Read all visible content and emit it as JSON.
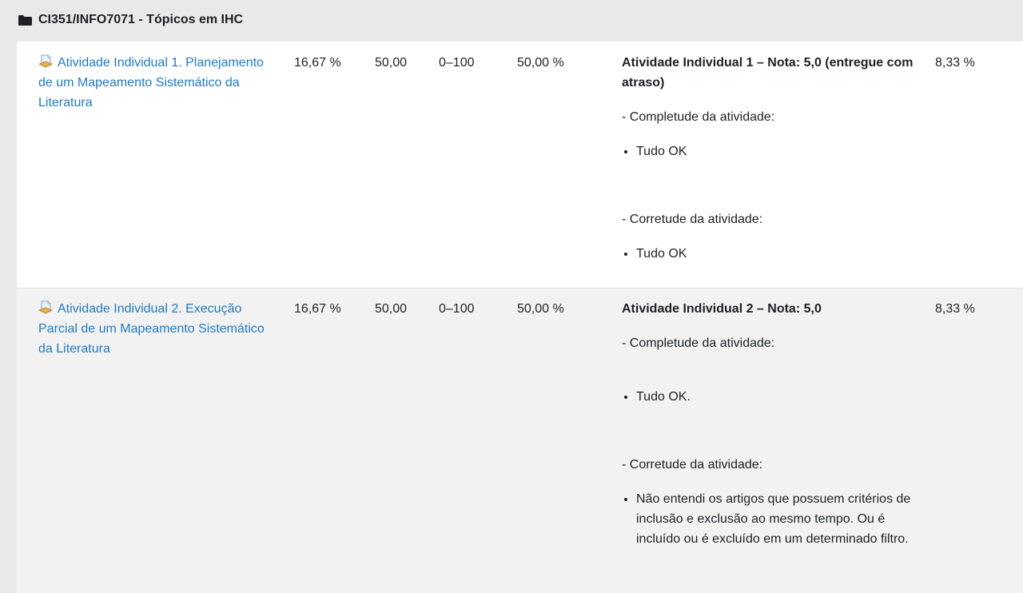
{
  "section": {
    "title": "CI351/INFO7071 - Tópicos em IHC"
  },
  "rows": [
    {
      "item": "Atividade Individual 1. Planejamento de um Mapeamento Sistemático da Literatura",
      "weight": "16,67 %",
      "grade": "50,00",
      "range": "0–100",
      "percentage": "50,00 %",
      "feedback": {
        "title": "Atividade Individual 1 – Nota: 5,0 (entregue com atraso)",
        "completeness_label": "- Completude da atividade:",
        "completeness_items": [
          "Tudo OK"
        ],
        "correctness_label": "- Corretude da atividade:",
        "correctness_items": [
          "Tudo OK"
        ]
      },
      "contribution": "8,33 %"
    },
    {
      "item": "Atividade Individual 2. Execução Parcial de um Mapeamento Sistemático da Literatura",
      "weight": "16,67 %",
      "grade": "50,00",
      "range": "0–100",
      "percentage": "50,00 %",
      "feedback": {
        "title": "Atividade Individual 2 – Nota: 5,0",
        "completeness_label": "- Completude da atividade:",
        "completeness_items": [
          "Tudo OK."
        ],
        "correctness_label": "- Corretude da atividade:",
        "correctness_items": [
          "Não entendi os artigos que possuem critérios de inclusão e exclusão ao mesmo tempo. Ou é incluído ou é excluído em um determinado filtro."
        ]
      },
      "contribution": "8,33 %"
    }
  ]
}
